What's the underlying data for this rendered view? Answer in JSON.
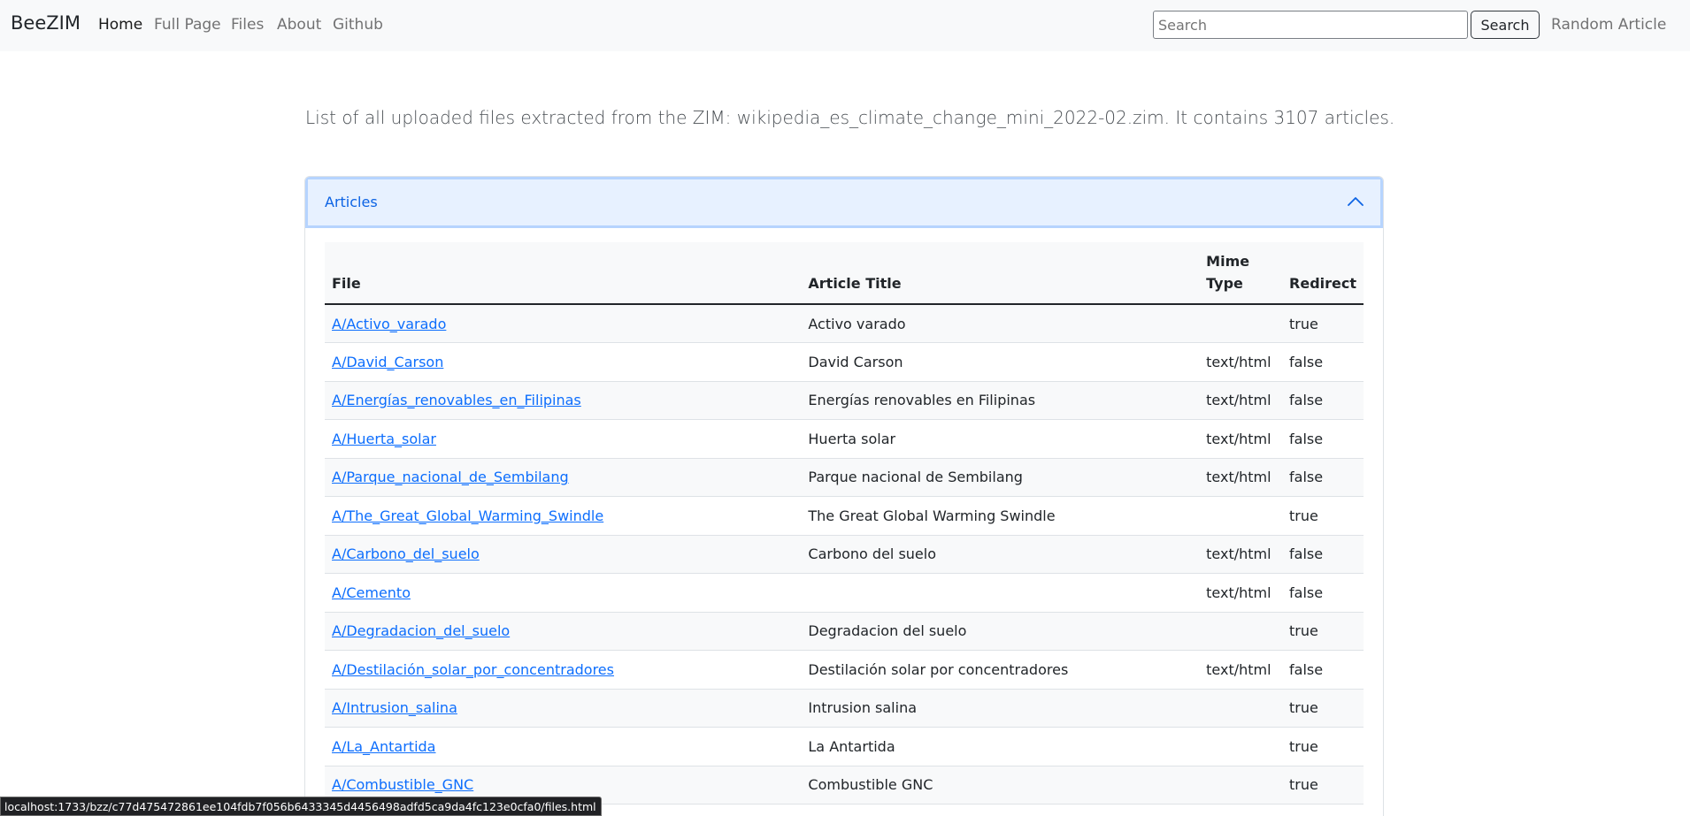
{
  "navbar": {
    "brand": "BeeZIM",
    "links": [
      "Home",
      "Full Page",
      "Files",
      "About",
      "Github"
    ],
    "search_placeholder": "Search",
    "search_button": "Search",
    "random_article": "Random Article"
  },
  "lead_text": "List of all uploaded files extracted from the ZIM: wikipedia_es_climate_change_mini_2022-02.zim. It contains 3107 articles.",
  "accordion": {
    "title": "Articles",
    "icon": "chevron-up-icon",
    "expanded": true
  },
  "table": {
    "headers": [
      "File",
      "Article Title",
      "Mime Type",
      "Redirect"
    ],
    "rows": [
      {
        "file": "A/Activo_varado",
        "title": "Activo varado",
        "mime": "",
        "redirect": "true"
      },
      {
        "file": "A/David_Carson",
        "title": "David Carson",
        "mime": "text/html",
        "redirect": "false"
      },
      {
        "file": "A/Energías_renovables_en_Filipinas",
        "title": "Energías renovables en Filipinas",
        "mime": "text/html",
        "redirect": "false"
      },
      {
        "file": "A/Huerta_solar",
        "title": "Huerta solar",
        "mime": "text/html",
        "redirect": "false"
      },
      {
        "file": "A/Parque_nacional_de_Sembilang",
        "title": "Parque nacional de Sembilang",
        "mime": "text/html",
        "redirect": "false"
      },
      {
        "file": "A/The_Great_Global_Warming_Swindle",
        "title": "The Great Global Warming Swindle",
        "mime": "",
        "redirect": "true"
      },
      {
        "file": "A/Carbono_del_suelo",
        "title": "Carbono del suelo",
        "mime": "text/html",
        "redirect": "false"
      },
      {
        "file": "A/Cemento",
        "title": "",
        "mime": "text/html",
        "redirect": "false"
      },
      {
        "file": "A/Degradacion_del_suelo",
        "title": "Degradacion del suelo",
        "mime": "",
        "redirect": "true"
      },
      {
        "file": "A/Destilación_solar_por_concentradores",
        "title": "Destilación solar por concentradores",
        "mime": "text/html",
        "redirect": "false"
      },
      {
        "file": "A/Intrusion_salina",
        "title": "Intrusion salina",
        "mime": "",
        "redirect": "true"
      },
      {
        "file": "A/La_Antartida",
        "title": "La Antartida",
        "mime": "",
        "redirect": "true"
      },
      {
        "file": "A/Combustible_GNC",
        "title": "Combustible GNC",
        "mime": "",
        "redirect": "true"
      },
      {
        "file": "",
        "title": "",
        "mime": "",
        "redirect": ""
      }
    ]
  },
  "status_bar": "localhost:1733/bzz/c77d475472861ee104fdb7f056b6433345d4456498adfd5ca9da4fc123e0cfa0/files.html",
  "colors": {
    "navbar_bg": "#f8f9fa",
    "link": "#0d6efd",
    "accordion_active_bg": "#e7f1ff",
    "accordion_active_text": "#0c63e4"
  }
}
